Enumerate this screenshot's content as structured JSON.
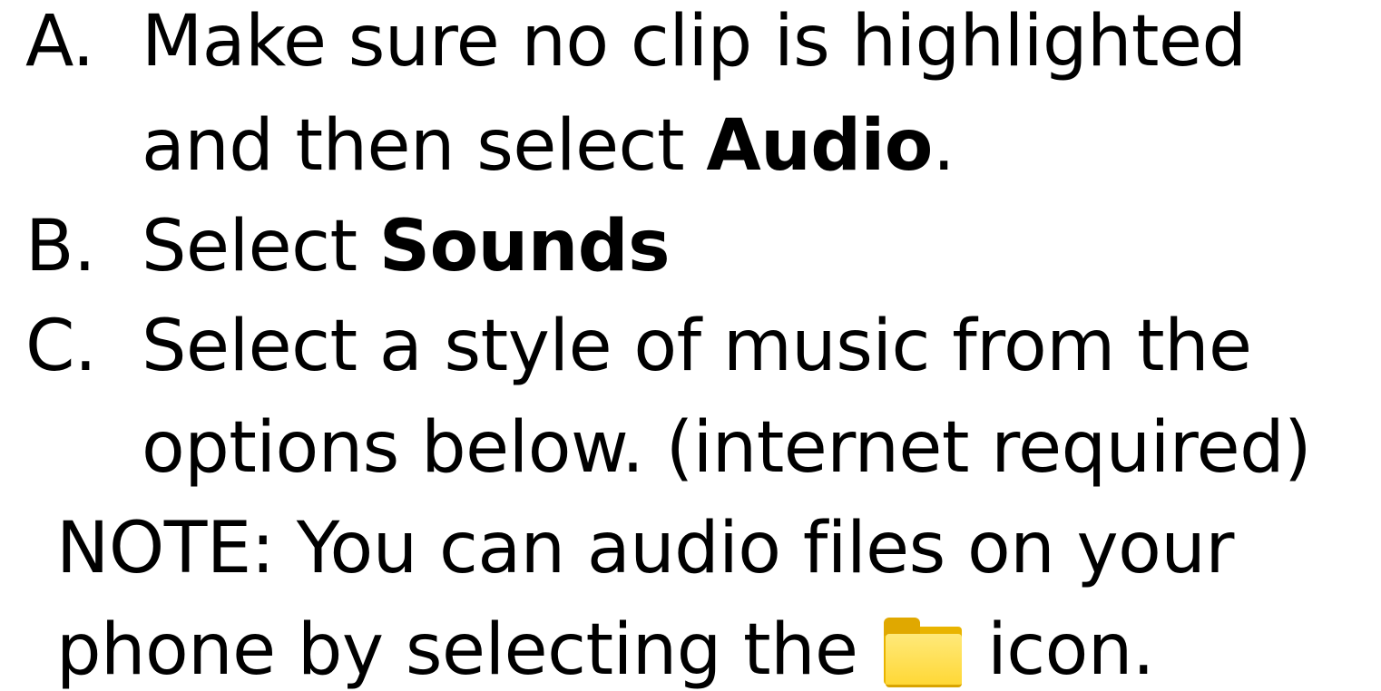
{
  "steps": [
    {
      "marker": "A.",
      "line1": "Make sure no clip is highlighted",
      "line2_prefix": "and then select ",
      "line2_bold": "Audio",
      "line2_suffix": "."
    },
    {
      "marker": "B.",
      "prefix": "Select ",
      "bold": "Sounds"
    },
    {
      "marker": "C.",
      "line1": "Select a style of music from the",
      "line2": "options below. (internet required)"
    }
  ],
  "note": {
    "line1": "NOTE: You can audio files on your",
    "line2_prefix": "phone by selecting the ",
    "line2_suffix": " icon.",
    "icon": "folder-icon"
  },
  "colors": {
    "text": "#000000",
    "background": "#ffffff",
    "folder": "#ffd836"
  }
}
